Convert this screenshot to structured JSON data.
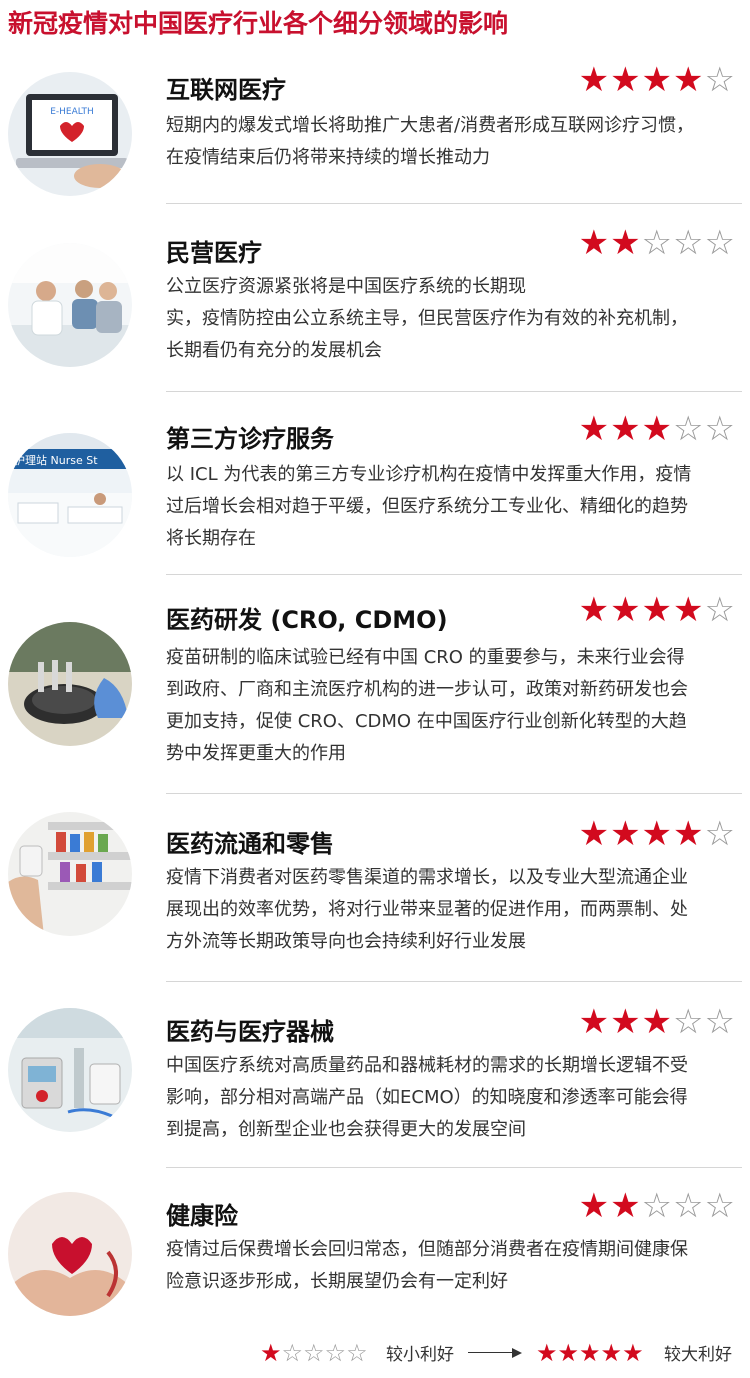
{
  "title": "新冠疫情对中国医疗行业各个细分领域的影响",
  "colors": {
    "accent": "#c8102e",
    "star_on": "#d20a1e",
    "star_off": "#9a9a9a"
  },
  "sectors": [
    {
      "name": "互联网医疗",
      "rating": 4,
      "description_lines": [
        "短期内的爆发式增长将助推广大患者/消费者形成互联网诊疗习惯，",
        "在疫情结束后仍将带来持续的增长推动力"
      ],
      "image": "laptop-e-health-photo",
      "image_text": "E-HEALTH"
    },
    {
      "name": "民营医疗",
      "rating": 2,
      "description_lines": [
        "公立医疗资源紧张将是中国医疗系统的长期现",
        "实，疫情防控由公立系统主导，但民营医疗作为有效的补充机制，",
        "长期看仍有充分的发展机会"
      ],
      "image": "clinic-consultation-photo"
    },
    {
      "name": "第三方诊疗服务",
      "rating": 3,
      "description_lines": [
        "以 ICL 为代表的第三方专业诊疗机构在疫情中发挥重大作用，疫情",
        "过后增长会相对趋于平缓，但医疗系统分工专业化、精细化的趋势",
        "将长期存在"
      ],
      "image": "nurse-station-photo",
      "image_text": "护理站 Nurse St"
    },
    {
      "name": "医药研发 (CRO, CDMO)",
      "rating": 4,
      "description_lines": [
        "疫苗研制的临床试验已经有中国 CRO 的重要参与，未来行业会得",
        "到政府、厂商和主流医疗机构的进一步认可，政策对新药研发也会",
        "更加支持，促使 CRO、CDMO 在中国医疗行业创新化转型的大趋",
        "势中发挥更重大的作用"
      ],
      "image": "lab-research-photo"
    },
    {
      "name": "医药流通和零售",
      "rating": 4,
      "description_lines": [
        "疫情下消费者对医药零售渠道的需求增长，以及专业大型流通企业",
        "展现出的效率优势，将对行业带来显著的促进作用，而两票制、处",
        "方外流等长期政策导向也会持续利好行业发展"
      ],
      "image": "pharmacy-shelf-photo"
    },
    {
      "name": "医药与医疗器械",
      "rating": 3,
      "description_lines": [
        "中国医疗系统对高质量药品和器械耗材的需求的长期增长逻辑不受",
        "影响，部分相对高端产品（如ECMO）的知晓度和渗透率可能会得",
        "到提高，创新型企业也会获得更大的发展空间"
      ],
      "image": "medical-equipment-photo"
    },
    {
      "name": "健康险",
      "rating": 2,
      "description_lines": [
        "疫情过后保费增长会回归常态，但随部分消费者在疫情期间健康保",
        "险意识逐步形成，长期展望仍会有一定利好"
      ],
      "image": "heart-in-hands-photo"
    }
  ],
  "legend": {
    "low_rating": 1,
    "low_label": "较小利好",
    "high_rating": 5,
    "high_label": "较大利好"
  }
}
